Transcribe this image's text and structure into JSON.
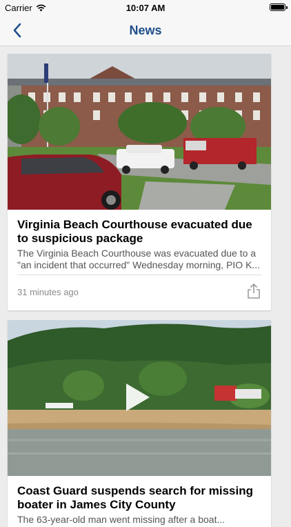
{
  "status_bar": {
    "carrier": "Carrier",
    "time": "10:07 AM"
  },
  "nav": {
    "title": "News",
    "back_icon": "chevron-left-icon"
  },
  "articles": [
    {
      "headline": "Virginia Beach Courthouse evacuated due to suspicious package",
      "summary": "The Virginia Beach Courthouse was evacuated due to a \"an incident that occurred\" Wednesday morning, PIO K...",
      "time_ago": "31 minutes ago",
      "share_icon": "share-icon",
      "image": "courthouse photo"
    },
    {
      "headline": "Coast Guard suspends search for missing boater in James City County",
      "summary": "The 63-year-old man went missing after a boat...",
      "image": "shoreline video thumbnail",
      "has_video": true
    }
  ],
  "colors": {
    "accent": "#1f4e8c",
    "background": "#ececec"
  }
}
